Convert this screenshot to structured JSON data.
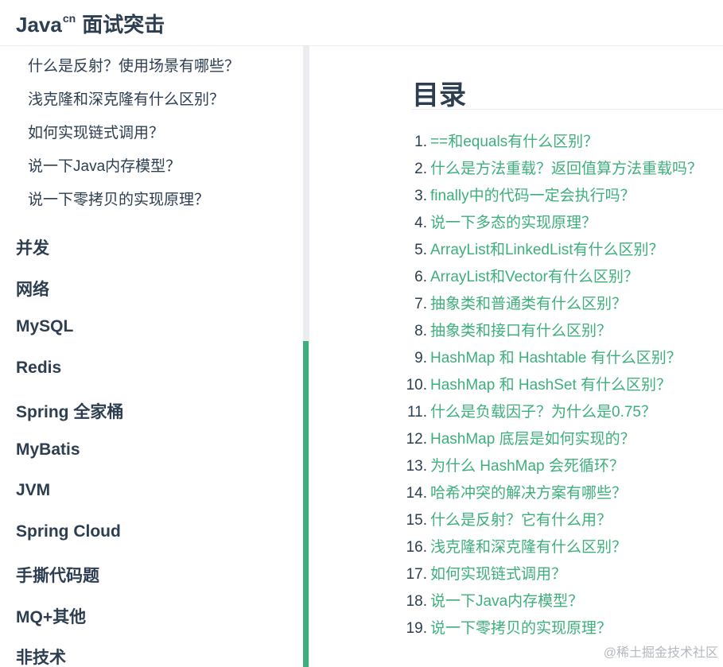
{
  "site": {
    "name": "Java",
    "sup": "cn",
    "suffix": "面试突击"
  },
  "sidebar": {
    "sub_items": [
      "什么是反射？使用场景有哪些？",
      "浅克隆和深克隆有什么区别？",
      "如何实现链式调用？",
      "说一下Java内存模型？",
      "说一下零拷贝的实现原理？"
    ],
    "groups": [
      "并发",
      "网络",
      "MySQL",
      "Redis",
      "Spring 全家桶",
      "MyBatis",
      "JVM",
      "Spring Cloud",
      "手撕代码题",
      "MQ+其他",
      "非技术"
    ]
  },
  "toc": {
    "title": "目录",
    "items": [
      {
        "num": "1.",
        "text": "==和equals有什么区别？"
      },
      {
        "num": "2.",
        "text": "什么是方法重载？返回值算方法重载吗？"
      },
      {
        "num": "3.",
        "text": "finally中的代码一定会执行吗？"
      },
      {
        "num": "4.",
        "text": "说一下多态的实现原理？"
      },
      {
        "num": "5.",
        "text": "ArrayList和LinkedList有什么区别？"
      },
      {
        "num": "6.",
        "text": "ArrayList和Vector有什么区别？"
      },
      {
        "num": "7.",
        "text": "抽象类和普通类有什么区别？"
      },
      {
        "num": "8.",
        "text": "抽象类和接口有什么区别？"
      },
      {
        "num": "9.",
        "text": "HashMap 和 Hashtable 有什么区别？"
      },
      {
        "num": "10.",
        "text": "HashMap 和 HashSet 有什么区别？"
      },
      {
        "num": "11.",
        "text": "什么是负载因子？为什么是0.75？"
      },
      {
        "num": "12.",
        "text": "HashMap 底层是如何实现的？"
      },
      {
        "num": "13.",
        "text": "为什么 HashMap 会死循环？"
      },
      {
        "num": "14.",
        "text": "哈希冲突的解决方案有哪些？"
      },
      {
        "num": "15.",
        "text": "什么是反射？它有什么用？"
      },
      {
        "num": "16.",
        "text": "浅克隆和深克隆有什么区别？"
      },
      {
        "num": "17.",
        "text": "如何实现链式调用？"
      },
      {
        "num": "18.",
        "text": "说一下Java内存模型？"
      },
      {
        "num": "19.",
        "text": "说一下零拷贝的实现原理？"
      }
    ]
  },
  "watermark": "@稀土掘金技术社区",
  "colors": {
    "accent": "#3eaf7c",
    "text": "#2c3e50",
    "border": "#eaecef"
  }
}
